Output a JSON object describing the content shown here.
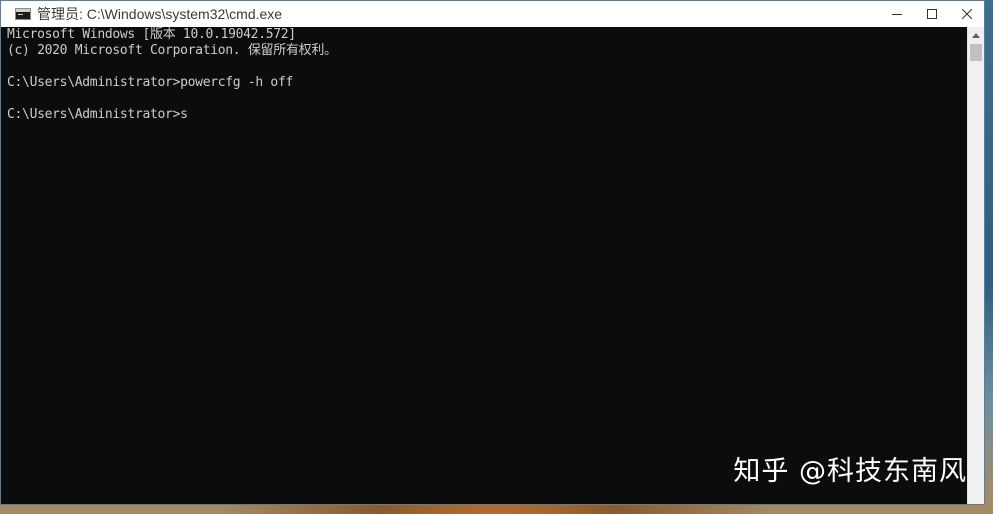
{
  "window": {
    "title": "管理员: C:\\Windows\\system32\\cmd.exe",
    "controls": {
      "minimize_icon": "minimize-icon",
      "maximize_icon": "maximize-icon",
      "close_icon": "close-icon"
    }
  },
  "console": {
    "lines": [
      "Microsoft Windows [版本 10.0.19042.572]",
      "(c) 2020 Microsoft Corporation. 保留所有权利。",
      "",
      "C:\\Users\\Administrator>powercfg -h off",
      "",
      "C:\\Users\\Administrator>s"
    ]
  },
  "watermark": {
    "text": "知乎 @科技东南风"
  },
  "colors": {
    "console_bg": "#0c0c0c",
    "console_text": "#cccccc",
    "titlebar_bg": "#ffffff"
  }
}
